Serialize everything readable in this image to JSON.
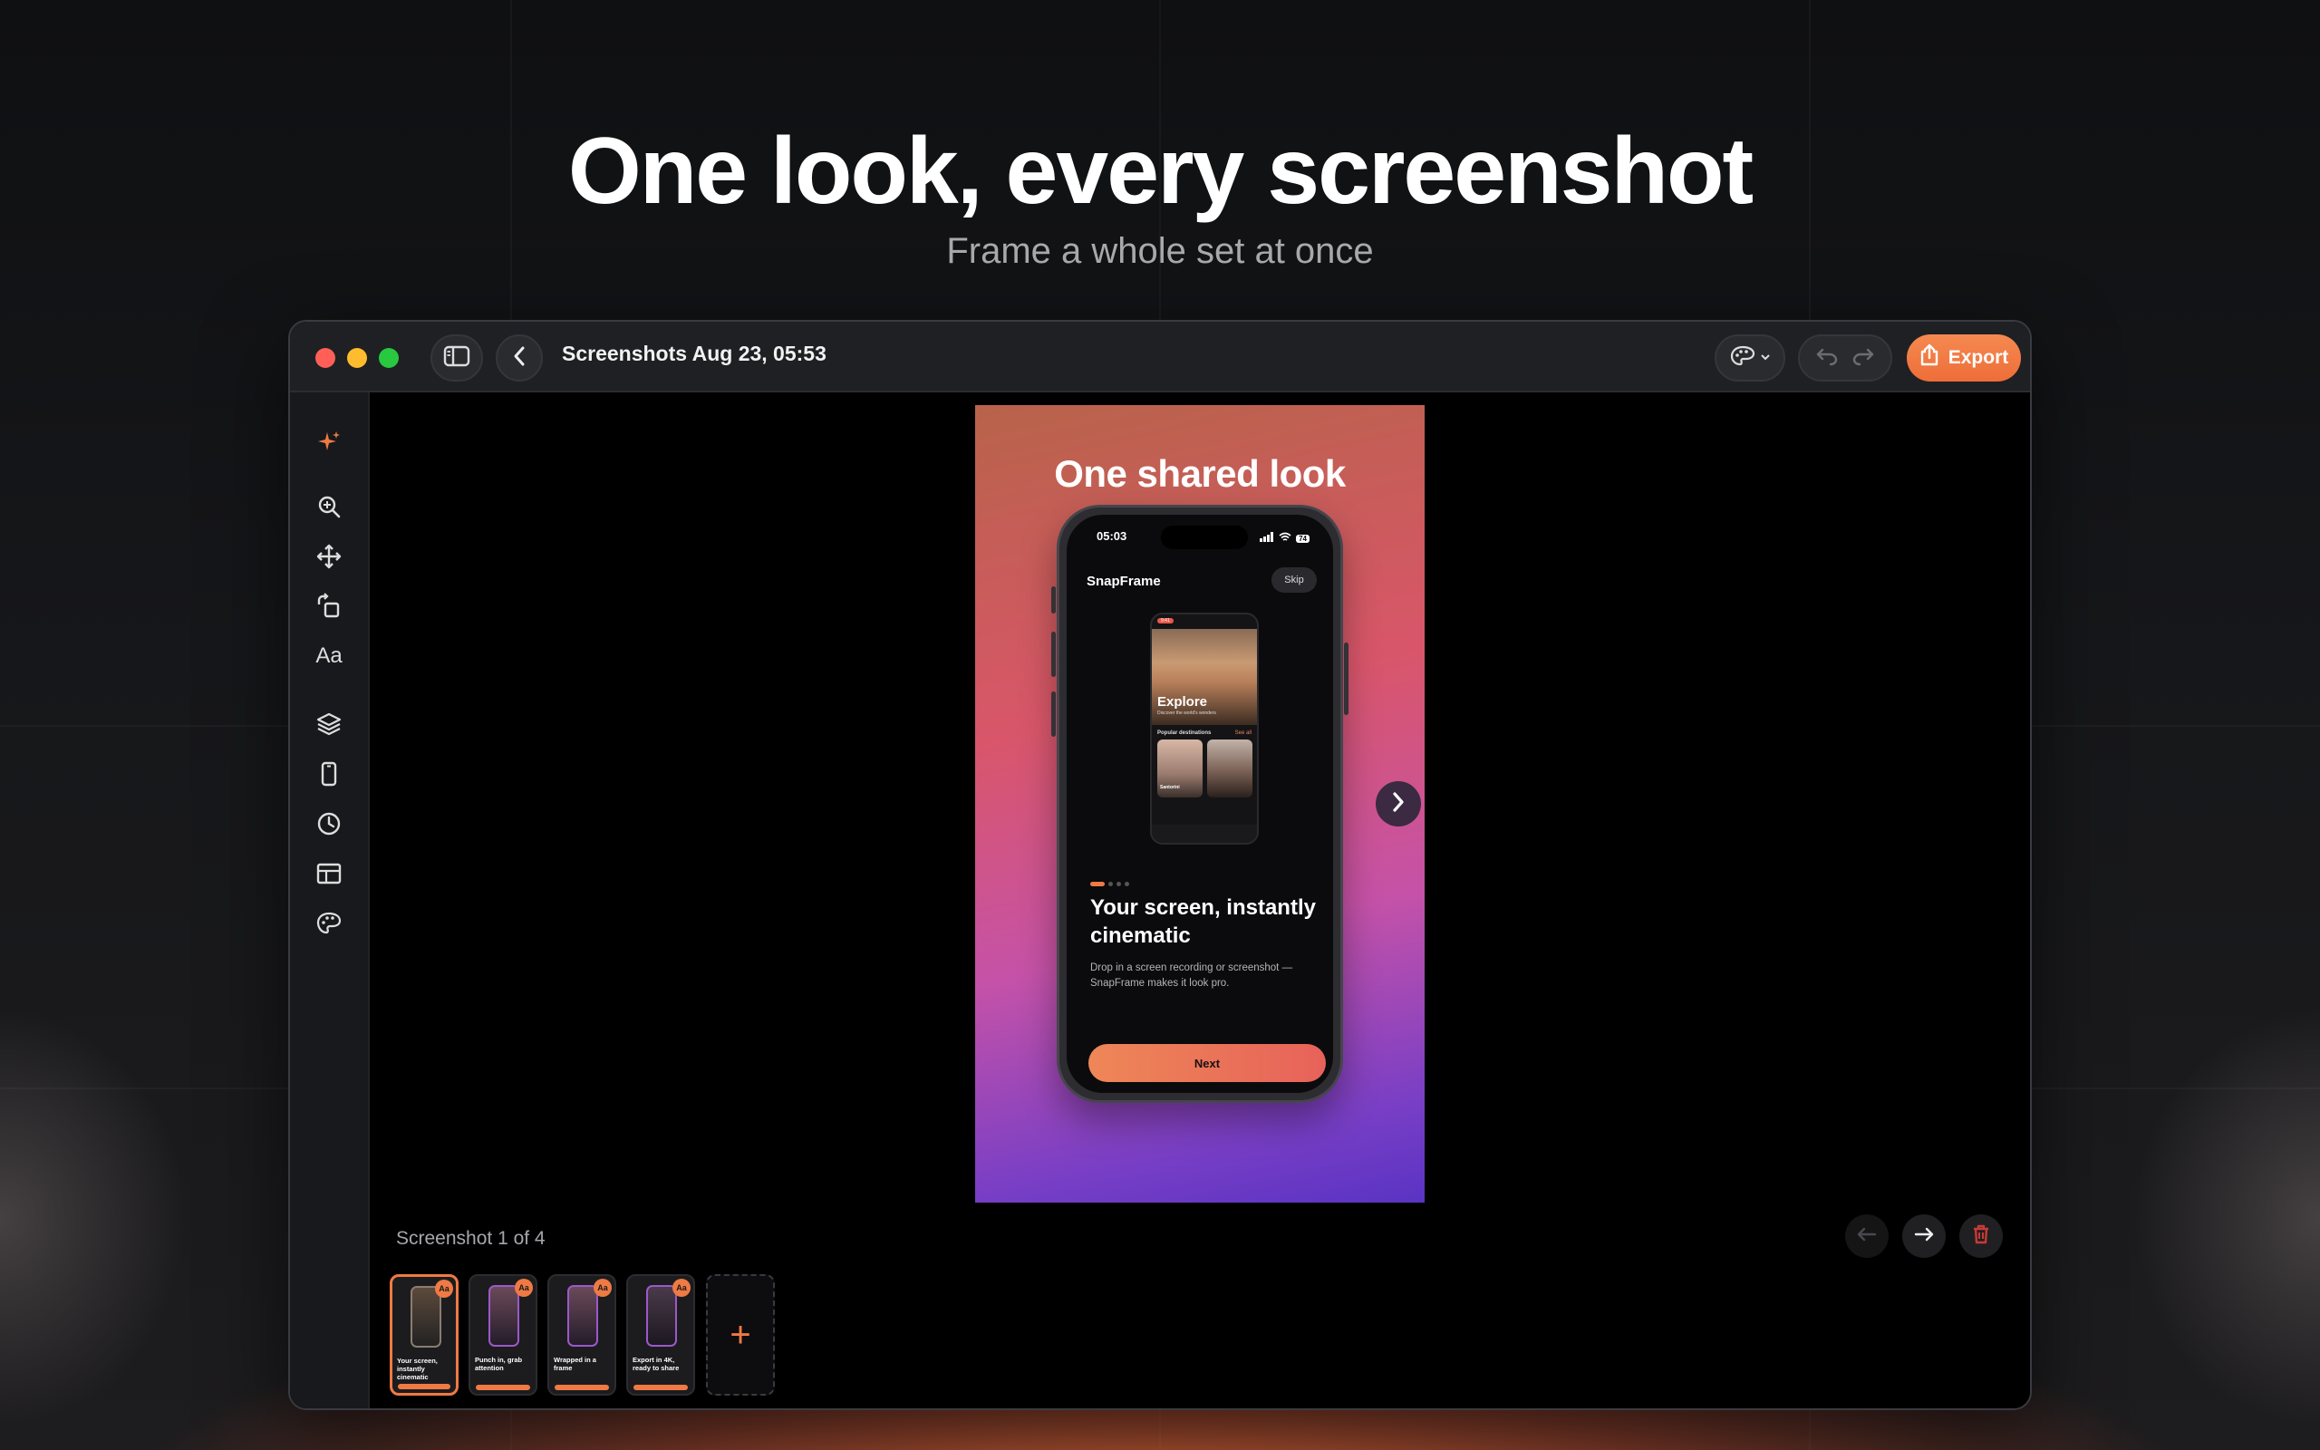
{
  "hero": {
    "title": "One look, every screenshot",
    "subtitle": "Frame a whole set at once"
  },
  "window": {
    "title": "Screenshots Aug 23, 05:53",
    "export_label": "Export",
    "accent_color": "#EE7A44"
  },
  "sidebar": {
    "tools": [
      "sparkle-icon",
      "zoom-icon",
      "move-icon",
      "rotate-icon",
      "text-tool",
      "layers-icon",
      "device-icon",
      "timer-icon",
      "layout-icon",
      "palette-icon"
    ],
    "text_tool_label": "Aa"
  },
  "preview": {
    "title": "One shared look",
    "phone": {
      "time": "05:03",
      "battery": "74",
      "app_name": "SnapFrame",
      "skip_label": "Skip",
      "inner": {
        "badge": "9:41",
        "heading": "Explore",
        "subheading": "Discover the world's wonders",
        "section": "Popular destinations",
        "see_all": "See all",
        "card1_label": "Santorini"
      },
      "headline": "Your screen, instantly cinematic",
      "body": "Drop in a screen recording or screenshot — SnapFrame makes it look pro.",
      "next_label": "Next"
    }
  },
  "footer": {
    "counter": "Screenshot 1 of 4",
    "thumbnails": [
      {
        "caption": "Your screen, instantly cinematic",
        "aa": "Aa"
      },
      {
        "caption": "Punch in, grab attention",
        "aa": "Aa"
      },
      {
        "caption": "Wrapped in a frame",
        "aa": "Aa"
      },
      {
        "caption": "Export in 4K, ready to share",
        "aa": "Aa"
      }
    ],
    "add_label": "+"
  }
}
